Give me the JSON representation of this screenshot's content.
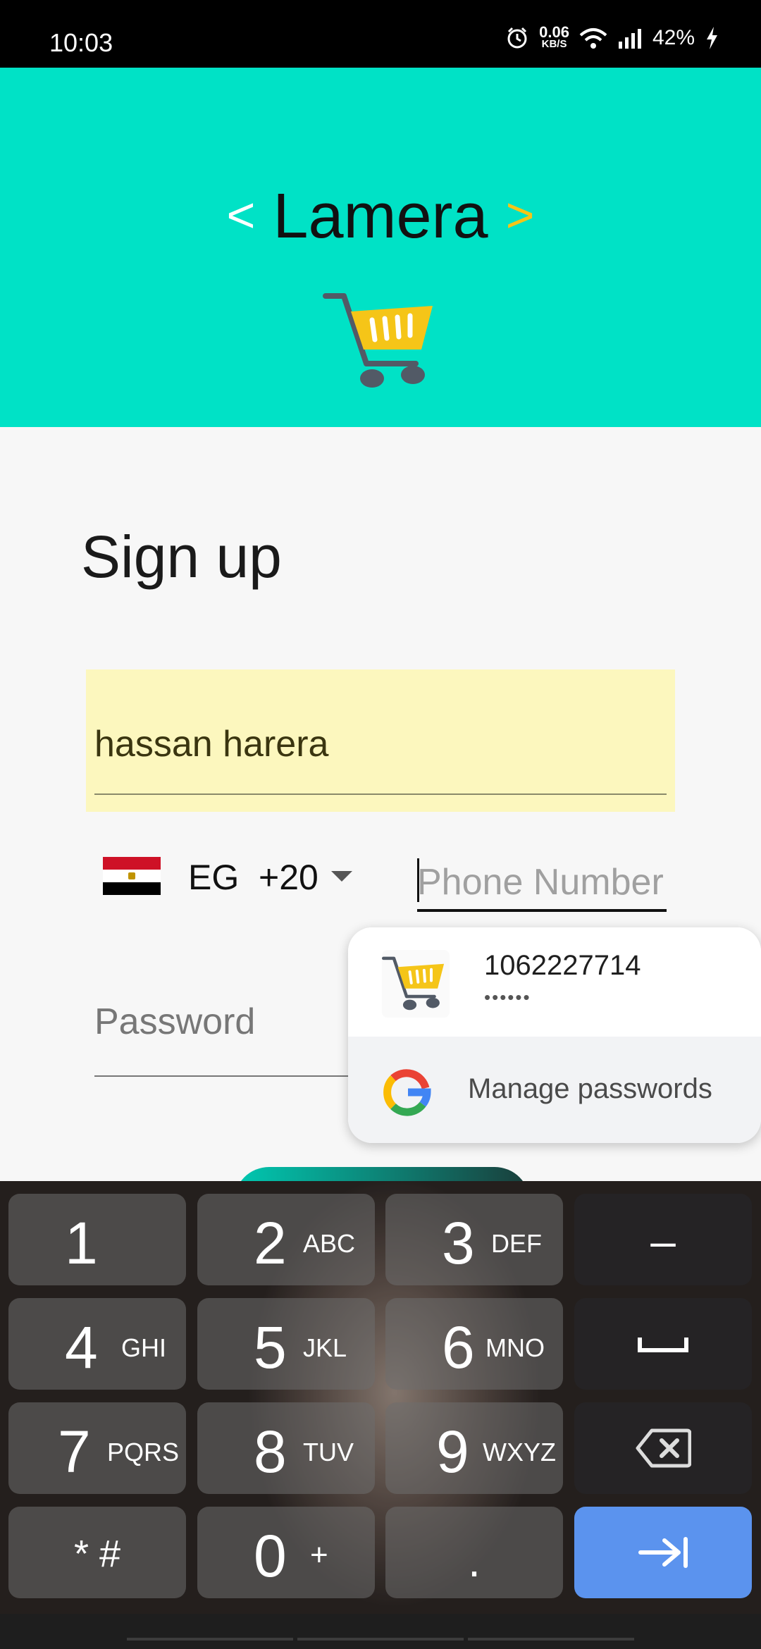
{
  "status_bar": {
    "time": "10:03",
    "net_speed_value": "0.06",
    "net_speed_unit": "KB/S",
    "battery": "42%",
    "icons": [
      "alarm-icon",
      "wifi-icon",
      "signal-icon",
      "charging-icon"
    ]
  },
  "header": {
    "bracket_left": "<",
    "app_name": "Lamera",
    "bracket_right": ">",
    "logo": "shopping-cart-icon",
    "colors": {
      "background": "#00e2c6",
      "accent": "#f5c518"
    }
  },
  "form": {
    "title": "Sign up",
    "name_value": "hassan harera",
    "country_code": "EG",
    "dial_code": "+20",
    "phone_placeholder": "Phone Number",
    "password_placeholder": "Password"
  },
  "autofill": {
    "username": "1062227714",
    "password_mask": "••••••",
    "manage_label": "Manage passwords"
  },
  "keyboard": {
    "rows": [
      [
        {
          "main": "1",
          "sub": ""
        },
        {
          "main": "2",
          "sub": "ABC"
        },
        {
          "main": "3",
          "sub": "DEF"
        },
        {
          "main": "–",
          "sub": ""
        }
      ],
      [
        {
          "main": "4",
          "sub": "GHI"
        },
        {
          "main": "5",
          "sub": "JKL"
        },
        {
          "main": "6",
          "sub": "MNO"
        },
        {
          "main": "␣",
          "sub": ""
        }
      ],
      [
        {
          "main": "7",
          "sub": "PQRS"
        },
        {
          "main": "8",
          "sub": "TUV"
        },
        {
          "main": "9",
          "sub": "WXYZ"
        },
        {
          "main": "⌫",
          "sub": ""
        }
      ],
      [
        {
          "main": "* #",
          "sub": ""
        },
        {
          "main": "0",
          "sub": "+"
        },
        {
          "main": ".",
          "sub": ""
        },
        {
          "main": "⇥",
          "sub": ""
        }
      ]
    ]
  }
}
